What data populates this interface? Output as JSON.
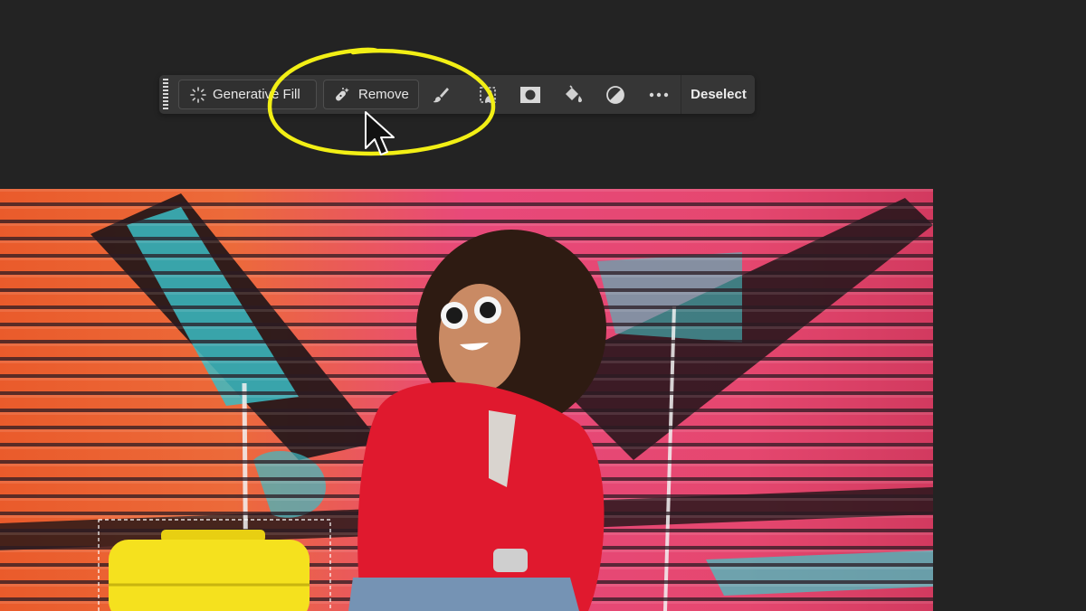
{
  "toolbar": {
    "generative_fill_label": "Generative Fill",
    "remove_label": "Remove",
    "deselect_label": "Deselect",
    "tools": [
      "brush-icon",
      "select-subject-icon",
      "mask-icon",
      "fill-bucket-icon",
      "adjustment-icon",
      "more-icon"
    ]
  },
  "colors": {
    "canvas_background": "#232323",
    "toolbar_background": "#363636",
    "annotation": "#f2ef15"
  }
}
